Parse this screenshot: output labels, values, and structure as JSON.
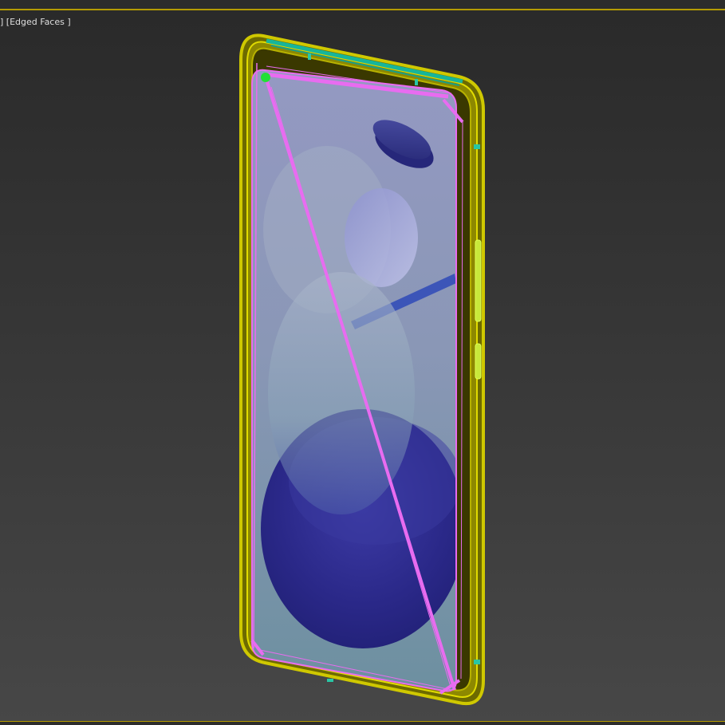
{
  "viewport": {
    "label_bracket": "]",
    "shading_mode": "[Edged Faces ]"
  },
  "scene": {
    "object": "phone-model",
    "colors": {
      "frame": "#c9c400",
      "frame_dark": "#8e8a00",
      "wire_selected": "#e86cf0",
      "wire_teal": "#17b59a",
      "vertex": "#22e035",
      "screen_top": "#8f93bd",
      "screen_bottom": "#6f8fa2",
      "shape_dark": "#2b2a8c"
    }
  }
}
